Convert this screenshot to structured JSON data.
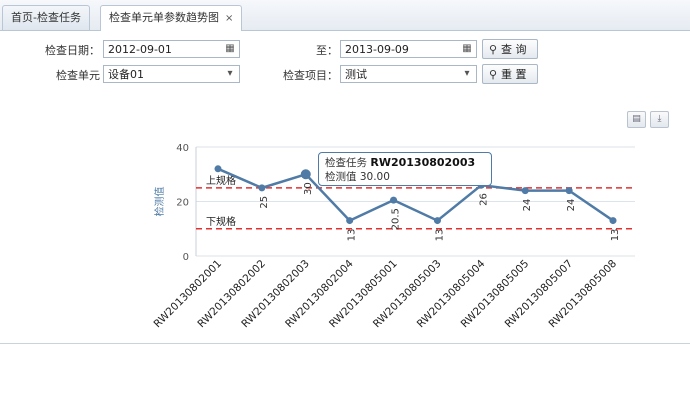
{
  "tabs": [
    {
      "label": "首页-检查任务"
    },
    {
      "label": "检查单元单参数趋势图",
      "close": "×"
    }
  ],
  "form": {
    "date_label": "检查日期：",
    "date_from": "2012-09-01",
    "to_label": "至：",
    "date_to": "2013-09-09",
    "unit_label": "检查单元",
    "unit_value": "设备01",
    "item_label": "检查项目：",
    "item_value": "测试",
    "query_button": "查 询",
    "reset_button": "重 置"
  },
  "chart_data": {
    "type": "line",
    "ylabel": "检测值",
    "ylim": [
      0,
      40
    ],
    "yticks": [
      "0",
      "20",
      "40"
    ],
    "categories": [
      "RW20130802001",
      "RW20130802002",
      "RW20130802003",
      "RW20130802004",
      "RW20130805001",
      "RW20130805003",
      "RW20130805004",
      "RW20130805005",
      "RW20130805007",
      "RW20130805008"
    ],
    "values": [
      32,
      25,
      30,
      13,
      20.5,
      13,
      26,
      24,
      24,
      13
    ],
    "data_labels": [
      "",
      "25",
      "30",
      "13",
      "20.5",
      "13",
      "26",
      "24",
      "24",
      "13"
    ],
    "upper_limit": {
      "value": 25,
      "label": "上规格"
    },
    "lower_limit": {
      "value": 10,
      "label": "下规格"
    },
    "line_color": "#4f7ba6",
    "limit_color": "#e03030"
  },
  "tooltip": {
    "task_label": "检查任务",
    "task_value": "RW20130802003",
    "value_label": "检测值",
    "value": "30.00"
  },
  "icons": {
    "print": "print-icon",
    "download": "download-icon"
  }
}
